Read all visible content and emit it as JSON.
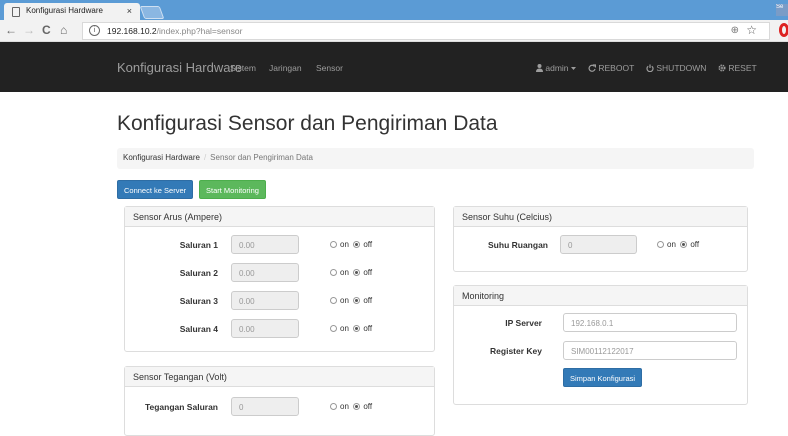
{
  "browser": {
    "tab_title": "Konfigurasi Hardware",
    "tab_close": "×",
    "url_host": "192.168.10.2",
    "url_path": "/index.php?hal=sensor",
    "info_glyph": "i",
    "zoom_glyph": "⊕",
    "star_glyph": "☆",
    "back_glyph": "←",
    "forward_glyph": "→",
    "reload_glyph": "C",
    "home_glyph": "⌂",
    "user_chip": "Se"
  },
  "navbar": {
    "brand": "Konfigurasi Hardware",
    "links": [
      "Sistem",
      "Jaringan",
      "Sensor"
    ],
    "user": "admin",
    "reboot": "REBOOT",
    "shutdown": "SHUTDOWN",
    "reset": "RESET"
  },
  "page": {
    "title": "Konfigurasi Sensor dan Pengiriman Data",
    "breadcrumb": [
      "Konfigurasi Hardware",
      "Sensor dan Pengiriman Data"
    ],
    "breadcrumb_sep": "/",
    "connect_button": "Connect ke Server",
    "monitoring_button": "Start Monitoring"
  },
  "arus": {
    "heading": "Sensor Arus (Ampere)",
    "rows": [
      {
        "label": "Saluran 1",
        "value": "0.00",
        "state": "off"
      },
      {
        "label": "Saluran 2",
        "value": "0.00",
        "state": "off"
      },
      {
        "label": "Saluran 3",
        "value": "0.00",
        "state": "off"
      },
      {
        "label": "Saluran 4",
        "value": "0.00",
        "state": "off"
      }
    ]
  },
  "tegangan": {
    "heading": "Sensor Tegangan (Volt)",
    "rows": [
      {
        "label": "Tegangan Saluran",
        "value": "0",
        "state": "off"
      }
    ]
  },
  "suhu": {
    "heading": "Sensor Suhu (Celcius)",
    "rows": [
      {
        "label": "Suhu Ruangan",
        "value": "0",
        "state": "off"
      }
    ]
  },
  "monitoring": {
    "heading": "Monitoring",
    "ip_label": "IP Server",
    "ip_value": "192.168.0.1",
    "key_label": "Register Key",
    "key_value": "SIM00112122017",
    "save_button": "Simpan Konfigurasi"
  },
  "radio_labels": {
    "on": "on",
    "off": "off"
  }
}
